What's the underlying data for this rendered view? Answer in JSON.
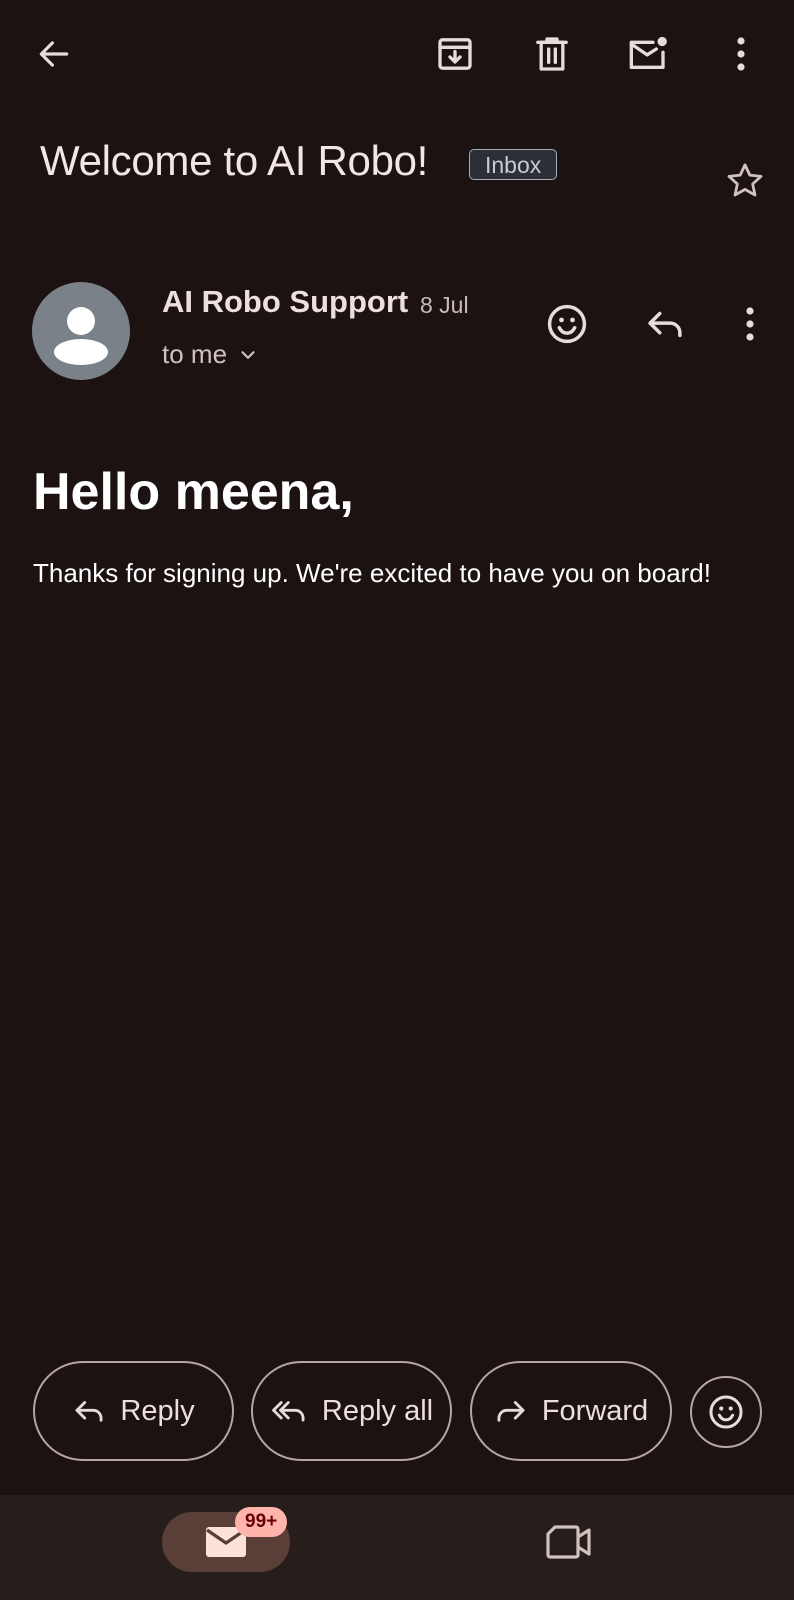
{
  "toolbar": {
    "back_icon": "arrow-left-icon",
    "archive_icon": "archive-icon",
    "delete_icon": "trash-icon",
    "mark_unread_icon": "mail-unread-icon",
    "more_icon": "more-vertical-icon"
  },
  "email": {
    "subject": "Welcome to AI Robo!",
    "label": "Inbox",
    "starred": false,
    "sender": {
      "name": "AI Robo Support",
      "date": "8 Jul",
      "recipient": "to me",
      "avatar_color": "#7b8189"
    },
    "greeting": "Hello meena,",
    "body": "Thanks for signing up. We're excited to have you on board!"
  },
  "actions": {
    "reply": "Reply",
    "reply_all": "Reply all",
    "forward": "Forward"
  },
  "bottom_nav": {
    "mail_badge": "99+",
    "mail_icon": "mail-icon",
    "meet_icon": "video-camera-icon"
  },
  "colors": {
    "background": "#1b1211",
    "nav_background": "#271d1b",
    "active_nav_pill": "#5a3f39",
    "badge": "#ffb4ab"
  }
}
